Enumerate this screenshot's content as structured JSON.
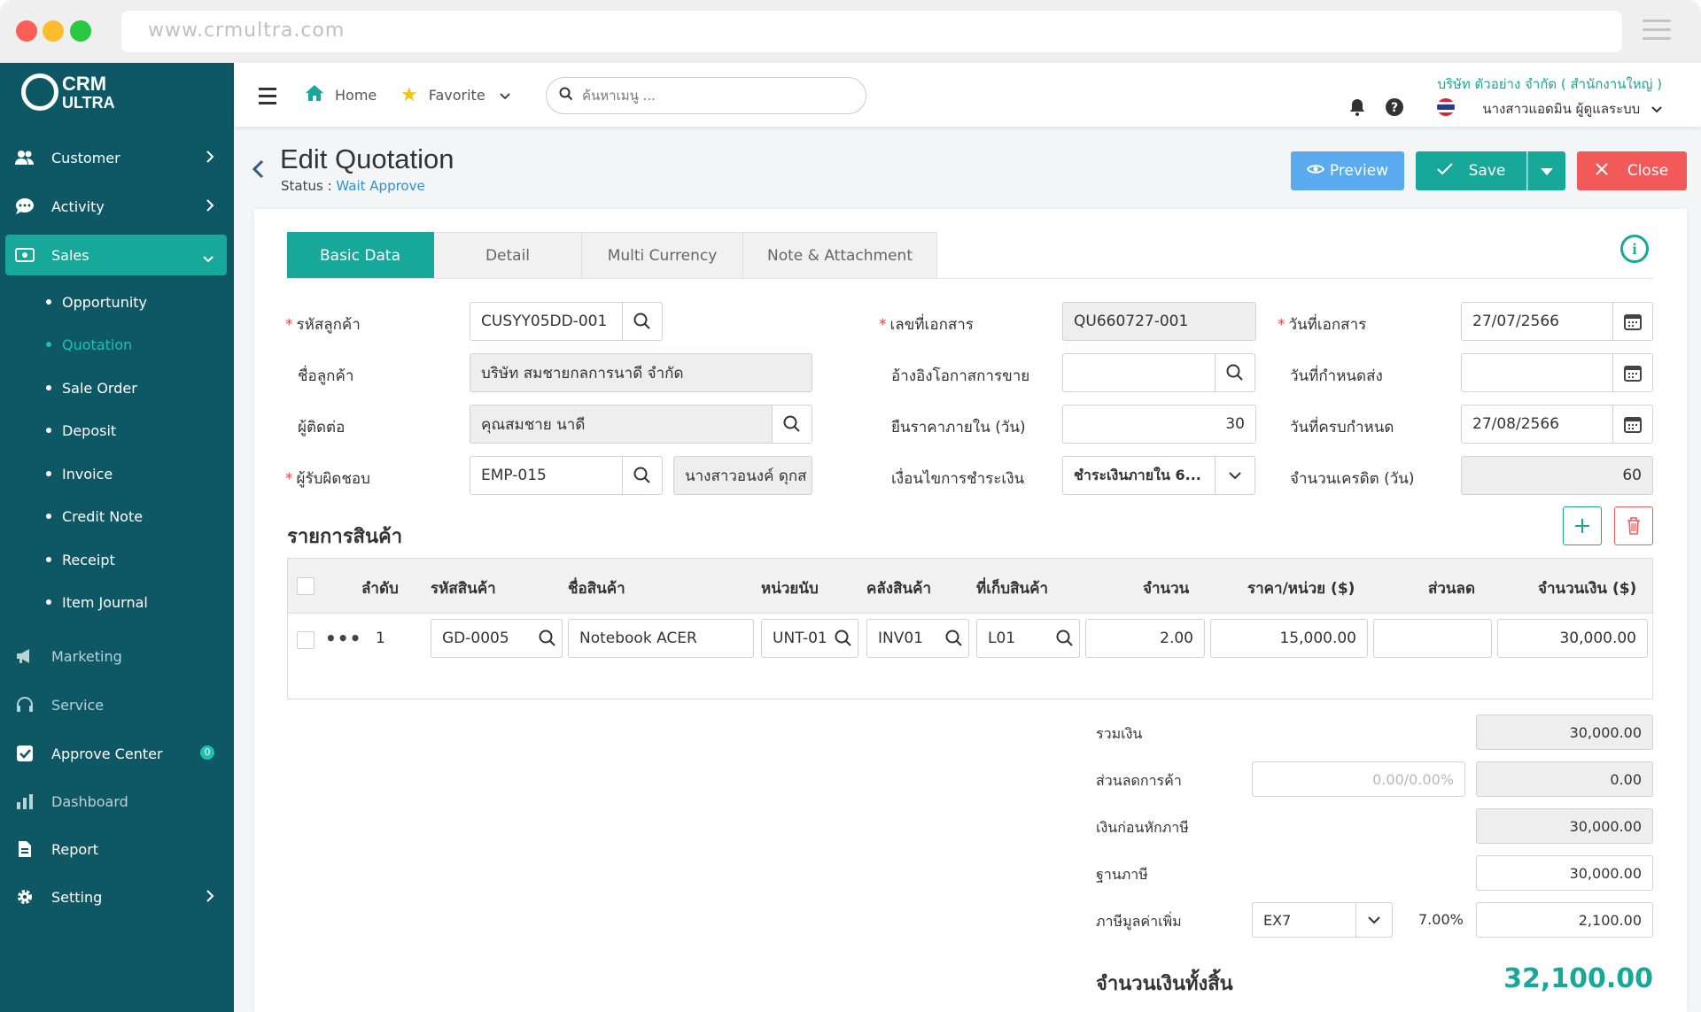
{
  "browser": {
    "url": "www.crmultra.com"
  },
  "brand": {
    "line1": "CRM",
    "line2": "ULTRA"
  },
  "sidebar": {
    "items": [
      {
        "label": "Customer"
      },
      {
        "label": "Activity"
      },
      {
        "label": "Sales"
      },
      {
        "label": "Marketing"
      },
      {
        "label": "Service"
      },
      {
        "label": "Approve Center",
        "badge": "0"
      },
      {
        "label": "Dashboard"
      },
      {
        "label": "Report"
      },
      {
        "label": "Setting"
      }
    ],
    "sales_sub": [
      "Opportunity",
      "Quotation",
      "Sale Order",
      "Deposit",
      "Invoice",
      "Credit Note",
      "Receipt",
      "Item Journal"
    ]
  },
  "topbar": {
    "home": "Home",
    "favorite": "Favorite",
    "search_placeholder": "ค้นหาเมนู ...",
    "company": "บริษัท ตัวอย่าง จำกัด ( สำนักงานใหญ่ )",
    "user": "นางสาวแอดมิน ผู้ดูแลระบบ"
  },
  "page": {
    "title": "Edit Quotation",
    "status_label": "Status :",
    "status_value": "Wait Approve",
    "preview": "Preview",
    "save": "Save",
    "close": "Close"
  },
  "tabs": [
    "Basic Data",
    "Detail",
    "Multi Currency",
    "Note & Attachment"
  ],
  "form": {
    "customer_code_label": "รหัสลูกค้า",
    "customer_code": "CUSYY05DD-001",
    "customer_name_label": "ชื่อลูกค้า",
    "customer_name": "บริษัท สมชายกลการนาดี จำกัด",
    "contact_label": "ผู้ติดต่อ",
    "contact": "คุณสมชาย นาดี",
    "owner_label": "ผู้รับผิดชอบ",
    "owner_code": "EMP-015",
    "owner_name": "นางสาวอนงค์ ดุกส",
    "doc_no_label": "เลขที่เอกสาร",
    "doc_no": "QU660727-001",
    "ref_opp_label": "อ้างอิงโอกาสการขาย",
    "ref_opp": "",
    "price_valid_label": "ยืนราคาภายใน (วัน)",
    "price_valid": "30",
    "payment_term_label": "เงื่อนไขการชำระเงิน",
    "payment_term": "ชำระเงินภายใน 6...",
    "doc_date_label": "วันที่เอกสาร",
    "doc_date": "27/07/2566",
    "delivery_date_label": "วันที่กำหนดส่ง",
    "delivery_date": "",
    "due_date_label": "วันที่ครบกำหนด",
    "due_date": "27/08/2566",
    "credit_days_label": "จำนวนเครดิต (วัน)",
    "credit_days": "60"
  },
  "products": {
    "title": "รายการสินค้า",
    "headers": [
      "ลำดับ",
      "รหัสสินค้า",
      "ชื่อสินค้า",
      "หน่วยนับ",
      "คลังสินค้า",
      "ที่เก็บสินค้า",
      "จำนวน",
      "ราคา/หน่วย ($)",
      "ส่วนลด",
      "จำนวนเงิน ($)"
    ],
    "rows": [
      {
        "no": "1",
        "code": "GD-0005",
        "name": "Notebook ACER",
        "unit": "UNT-01",
        "warehouse": "INV01",
        "location": "L01",
        "qty": "2.00",
        "price": "15,000.00",
        "discount": "",
        "amount": "30,000.00"
      }
    ]
  },
  "summary": {
    "subtotal_label": "รวมเงิน",
    "subtotal": "30,000.00",
    "trade_discount_label": "ส่วนลดการค้า",
    "trade_discount_placeholder": "0.00/0.00%",
    "trade_discount": "0.00",
    "before_tax_label": "เงินก่อนหักภาษี",
    "before_tax": "30,000.00",
    "tax_base_label": "ฐานภาษี",
    "tax_base": "30,000.00",
    "vat_label": "ภาษีมูลค่าเพิ่ม",
    "vat_code": "EX7",
    "vat_rate": "7.00%",
    "vat_amount": "2,100.00",
    "total_label": "จำนวนเงินทั้งสิ้น",
    "total": "32,100.00"
  },
  "colors": {
    "sidebar": "#0e5765",
    "accent": "#17a89a",
    "preview": "#5aaaf0",
    "close": "#f25a5a",
    "status": "#2f8fd8"
  }
}
